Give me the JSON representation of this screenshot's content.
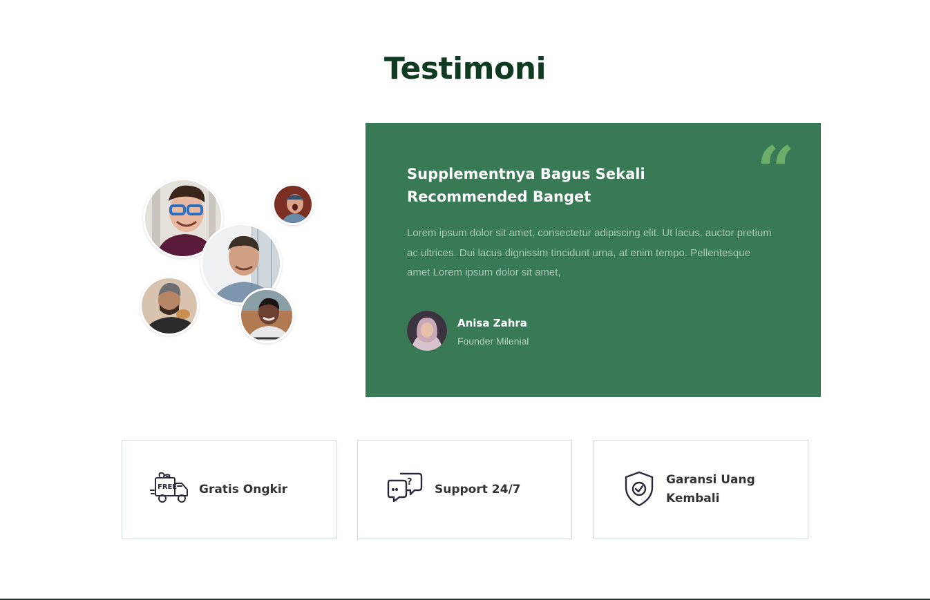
{
  "section": {
    "title": "Testimoni"
  },
  "avatars": [
    {
      "name": "avatar-glasses-man-icon"
    },
    {
      "name": "avatar-shouting-man-icon"
    },
    {
      "name": "avatar-smiling-man-icon"
    },
    {
      "name": "avatar-eating-man-icon"
    },
    {
      "name": "avatar-smiling-man-2-icon"
    }
  ],
  "testimonial": {
    "title": "Supplementnya Bagus Sekali Recommended Banget",
    "body": "Lorem ipsum dolor sit amet, consectetur adipiscing elit. Ut lacus, auctor pretium ac ultrices. Dui lacus dignissim tincidunt urna, at enim tempo. Pellentesque amet Lorem ipsum dolor sit amet,",
    "quote_mark": "“",
    "author": {
      "name": "Anisa Zahra",
      "role": "Founder Milenial"
    }
  },
  "features": [
    {
      "label": "Gratis Ongkir",
      "icon": "free-delivery-truck-icon"
    },
    {
      "label": "Support 24/7",
      "icon": "support-chat-icon"
    },
    {
      "label": "Garansi Uang Kembali",
      "icon": "shield-check-icon"
    }
  ],
  "colors": {
    "title": "#0f3b22",
    "card_bg": "#387a56",
    "quote_mark": "#6cae6a",
    "feature_border": "#c9dcd8"
  }
}
